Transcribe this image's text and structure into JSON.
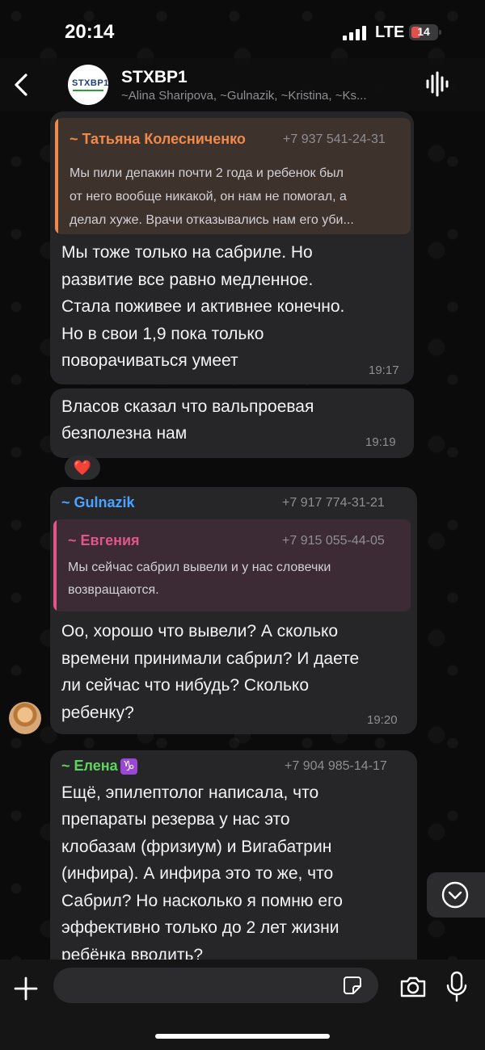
{
  "status_bar": {
    "time": "20:14",
    "network": "LTE",
    "battery": "14"
  },
  "header": {
    "title": "STXBP1",
    "subtitle": "~Alina Sharipova, ~Gulnazik, ~Kristina, ~Ks...",
    "avatar_logo": "STXBP1"
  },
  "messages": [
    {
      "quote": {
        "name": "~ Татьяна Колесниченко",
        "phone": "+7 937 541-24-31",
        "lines": [
          "Мы пили депакин почти 2 года и ребенок был",
          "от него вообще никакой, он нам не помогал, а",
          "делал хуже. Врачи отказывались нам его уби..."
        ]
      },
      "lines": [
        "Мы тоже только на сабриле. Но",
        "развитие все равно медленное.",
        "Стала поживее и активнее конечно.",
        "Но в свои 1,9 пока только",
        "поворачиваться умеет"
      ],
      "time": "19:17"
    },
    {
      "lines": [
        "Власов сказал что вальпроевая",
        "безполезна нам"
      ],
      "time": "19:19",
      "reaction": "❤️"
    },
    {
      "sender": "~ Gulnazik",
      "phone": "+7 917 774-31-21",
      "quote": {
        "name": "~ Евгения",
        "phone": "+7 915 055-44-05",
        "lines": [
          "Мы сейчас сабрил вывели и у нас словечки",
          "возвращаются."
        ]
      },
      "lines": [
        "Оо, хорошо что вывели? А сколько",
        "времени принимали сабрил? И даете",
        "ли сейчас что нибудь? Сколько",
        "ребенку?"
      ],
      "time": "19:20"
    },
    {
      "sender": "~ Елена",
      "sender_emoji": "♑",
      "phone": "+7 904 985-14-17",
      "lines": [
        "Ещё, эпилептолог написала, что",
        "препараты резерва у нас это",
        "клобазам (фризиум) и  Вигабатрин",
        "(инфира). А инфира это то же, что",
        "Сабрил? Но насколько я помню его",
        "эффективно только до 2 лет жизни",
        "ребёнка вводить?"
      ]
    }
  ],
  "colors": {
    "bubble": "#262628",
    "quote1": "#f08a4b",
    "quote2": "#e0558a",
    "gulnazik": "#4aa3ff",
    "elena": "#5fd35f"
  }
}
